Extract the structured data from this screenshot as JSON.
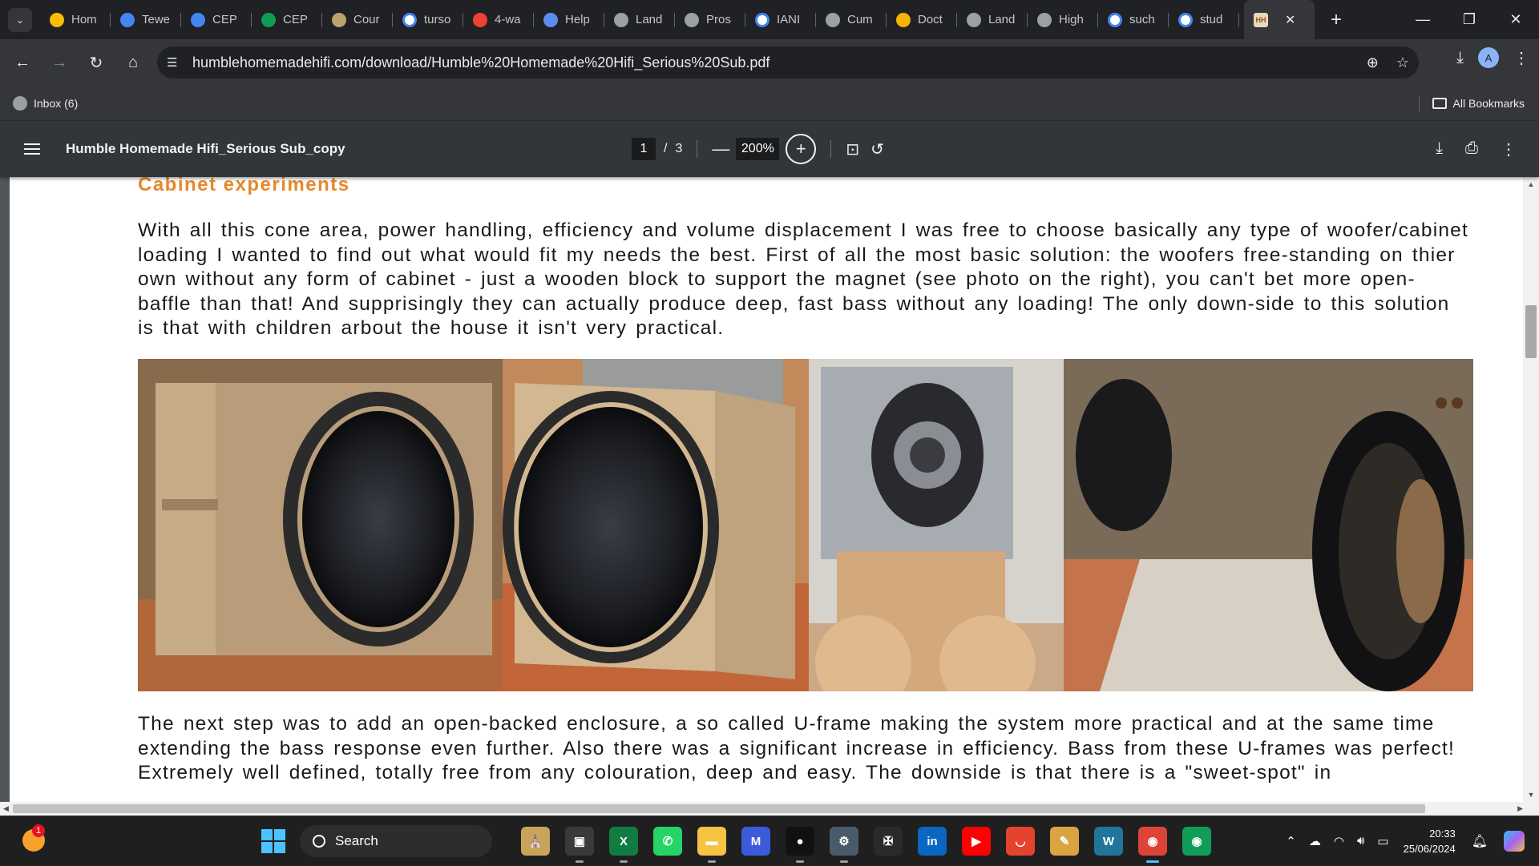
{
  "browser": {
    "tabs": [
      {
        "label": "Hom",
        "icon": "google-drive-icon",
        "color": "#fbbc04"
      },
      {
        "label": "Tewe",
        "icon": "google-docs-icon",
        "color": "#4285f4"
      },
      {
        "label": "CEP",
        "icon": "google-docs-icon",
        "color": "#4285f4"
      },
      {
        "label": "CEP",
        "icon": "google-sheets-icon",
        "color": "#0f9d58"
      },
      {
        "label": "Cour",
        "icon": "course-site-icon",
        "color": "#b8a36a"
      },
      {
        "label": "turso",
        "icon": "google-icon",
        "color": "#ffffff"
      },
      {
        "label": "4-wa",
        "icon": "gmail-icon",
        "color": "#ea4335"
      },
      {
        "label": "Help",
        "icon": "help-site-icon",
        "color": "#5b8def"
      },
      {
        "label": "Land",
        "icon": "globe-icon",
        "color": "#9aa0a6"
      },
      {
        "label": "Pros",
        "icon": "globe-icon",
        "color": "#9aa0a6"
      },
      {
        "label": "IANI",
        "icon": "google-icon",
        "color": "#ffffff"
      },
      {
        "label": "Cum",
        "icon": "globe-icon",
        "color": "#9aa0a6"
      },
      {
        "label": "Doct",
        "icon": "document-site-icon",
        "color": "#f4b400"
      },
      {
        "label": "Land",
        "icon": "globe-icon",
        "color": "#9aa0a6"
      },
      {
        "label": "High",
        "icon": "globe-icon",
        "color": "#9aa0a6"
      },
      {
        "label": "such",
        "icon": "google-icon",
        "color": "#ffffff"
      },
      {
        "label": "stud",
        "icon": "google-icon",
        "color": "#ffffff"
      }
    ],
    "active_tab_icon": "humble-homemade-hifi-icon",
    "url": "humblehomemadehifi.com/download/Humble%20Homemade%20Hifi_Serious%20Sub.pdf",
    "avatar_letter": "A",
    "bookmarks": {
      "inbox": "Inbox (6)",
      "all": "All Bookmarks"
    }
  },
  "pdf": {
    "title": "Humble Homemade Hifi_Serious Sub_copy",
    "page_current": "1",
    "page_total": "3",
    "zoom": "200%",
    "section_title": "Cabinet experiments",
    "paragraph1": "With all this cone area, power handling, efficiency and volume displacement I was free to choose basically any type of woofer/cabinet loading I wanted to find out what would fit my needs the best. First of all the most basic solution: the woofers free-standing on thier own without any form of cabinet - just a wooden block to support the magnet (see photo on the right), you can't bet more open-baffle than that! And supprisingly they can actually produce deep, fast bass without any loading! The only down-side to this solution is that with children arbout the house it isn't very practical.",
    "paragraph2": "The next step was to add an open-backed enclosure, a so called U-frame making the system more practical and at the same time extending the bass response even further. Also there was a significant increase in efficiency. Bass from these U-frames was perfect! Extremely well defined, totally free from any colouration, deep and easy. The downside is that there is a \"sweet-spot\" in"
  },
  "taskbar": {
    "weather_badge": "1",
    "search_placeholder": "Search",
    "apps": [
      {
        "name": "cathedral-widget-icon",
        "color": "#c8a45a",
        "glyph": "⛪"
      },
      {
        "name": "task-view-icon",
        "color": "#3a3a3a",
        "glyph": "▣"
      },
      {
        "name": "excel-icon",
        "color": "#107c41",
        "glyph": "X"
      },
      {
        "name": "whatsapp-icon",
        "color": "#25d366",
        "glyph": "✆"
      },
      {
        "name": "file-explorer-icon",
        "color": "#f6c343",
        "glyph": "▬"
      },
      {
        "name": "mathway-icon",
        "color": "#3b5bdb",
        "glyph": "M"
      },
      {
        "name": "red-app-icon",
        "color": "#111111",
        "glyph": "●"
      },
      {
        "name": "settings-icon",
        "color": "#4a5a6a",
        "glyph": "⚙"
      },
      {
        "name": "school-crest-icon",
        "color": "#2a2a2a",
        "glyph": "✠"
      },
      {
        "name": "linkedin-icon",
        "color": "#0a66c2",
        "glyph": "in"
      },
      {
        "name": "youtube-icon",
        "color": "#ff0000",
        "glyph": "▶"
      },
      {
        "name": "office-red-icon",
        "color": "#e4432d",
        "glyph": "◡"
      },
      {
        "name": "notes-app-icon",
        "color": "#d9a441",
        "glyph": "✎"
      },
      {
        "name": "wordpress-icon",
        "color": "#21759b",
        "glyph": "W"
      },
      {
        "name": "chrome-profile-a-icon",
        "color": "#db4437",
        "glyph": "◉"
      },
      {
        "name": "chrome-profile-d-icon",
        "color": "#0f9d58",
        "glyph": "◉"
      }
    ],
    "time": "20:33",
    "date": "25/06/2024"
  }
}
